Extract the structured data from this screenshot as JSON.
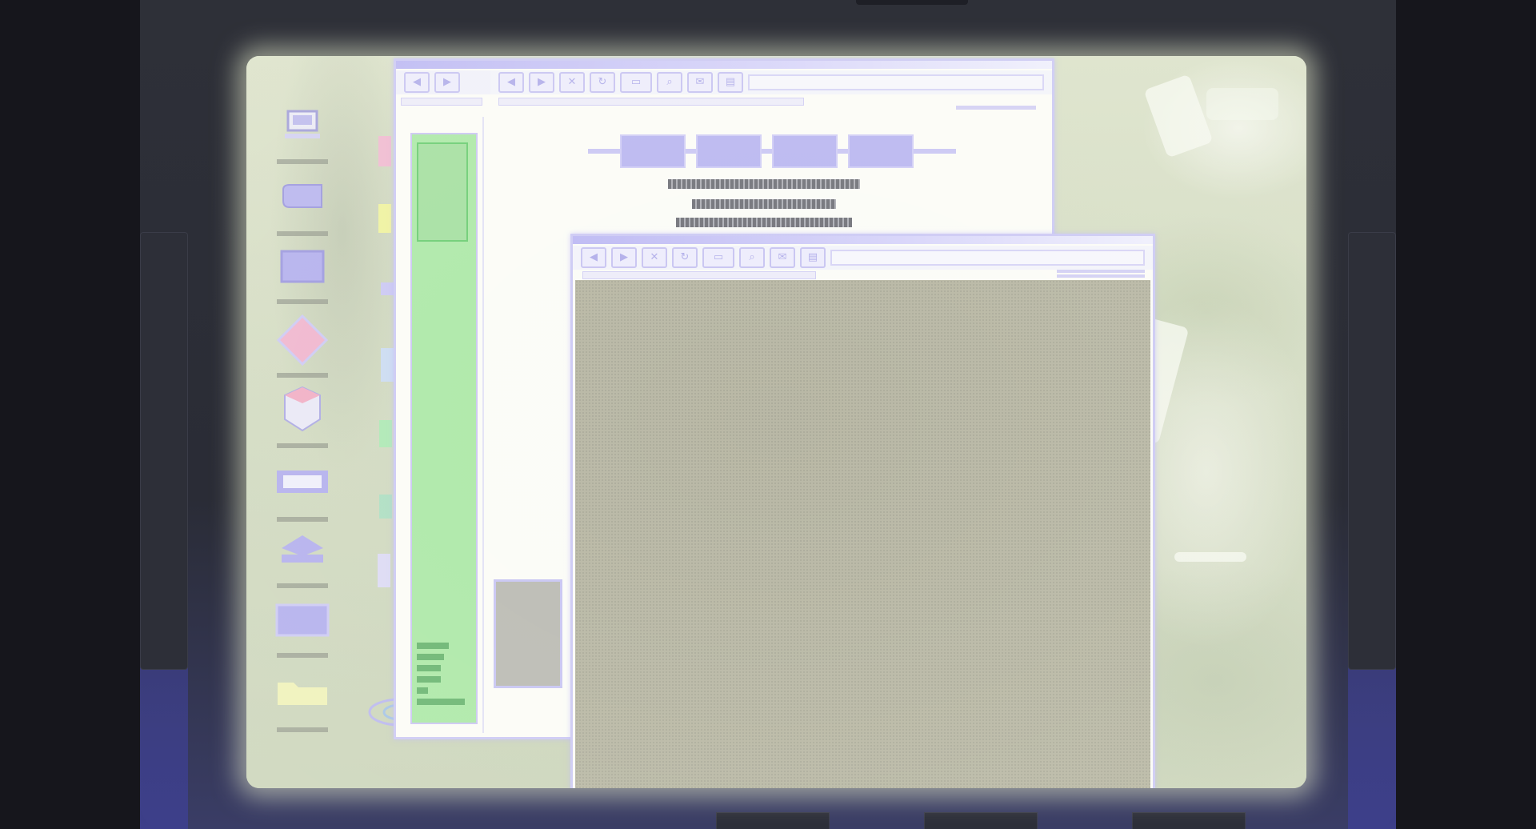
{
  "screen": {
    "wallpaper": "overexposed-forest-photo",
    "accent_color": "#c9c6f5",
    "panel_color": "#a7e7a3"
  },
  "desktop_icons": [
    {
      "name": "computer-icon"
    },
    {
      "name": "disk-icon"
    },
    {
      "name": "monitor-icon"
    },
    {
      "name": "diamond-icon"
    },
    {
      "name": "box-icon"
    },
    {
      "name": "keyboard-icon"
    },
    {
      "name": "stack-icon"
    },
    {
      "name": "window-icon"
    },
    {
      "name": "folder-icon"
    }
  ],
  "window_back": {
    "toolbar_icons": [
      "back-arrow-icon",
      "forward-arrow-icon",
      "close-x-icon",
      "refresh-icon",
      "home-icon",
      "search-icon",
      "mail-icon",
      "print-icon"
    ],
    "nav_icons": [
      "back-arrow-icon",
      "forward-arrow-icon"
    ],
    "tab_count": 4,
    "text_lines": 3
  },
  "window_front": {
    "toolbar_icons": [
      "back-arrow-icon",
      "forward-arrow-icon",
      "close-x-icon",
      "refresh-icon",
      "home-icon",
      "search-icon",
      "mail-icon",
      "print-icon"
    ]
  },
  "glyphs": {
    "back": "◀",
    "forward": "▶",
    "close": "✕",
    "refresh": "↻",
    "home": "▭",
    "search": "⌕",
    "mail": "✉",
    "print": "▤"
  }
}
